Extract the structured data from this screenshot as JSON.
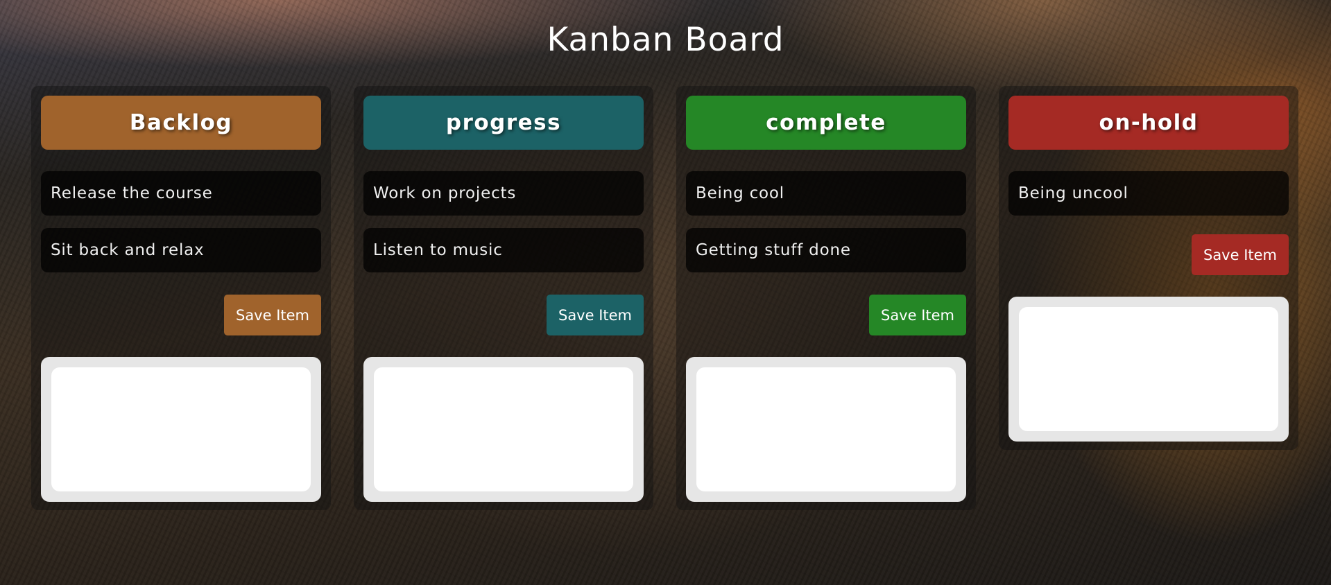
{
  "title": "Kanban Board",
  "columns": [
    {
      "name": "Backlog",
      "color": "#a0632c",
      "items": [
        "Release the course",
        "Sit back and relax"
      ],
      "save_label": "Save Item"
    },
    {
      "name": "progress",
      "color": "#1c6266",
      "items": [
        "Work on projects",
        "Listen to music"
      ],
      "save_label": "Save Item"
    },
    {
      "name": "complete",
      "color": "#258726",
      "items": [
        "Being cool",
        "Getting stuff done"
      ],
      "save_label": "Save Item"
    },
    {
      "name": "on-hold",
      "color": "#a52a24",
      "items": [
        "Being uncool"
      ],
      "save_label": "Save Item"
    }
  ]
}
